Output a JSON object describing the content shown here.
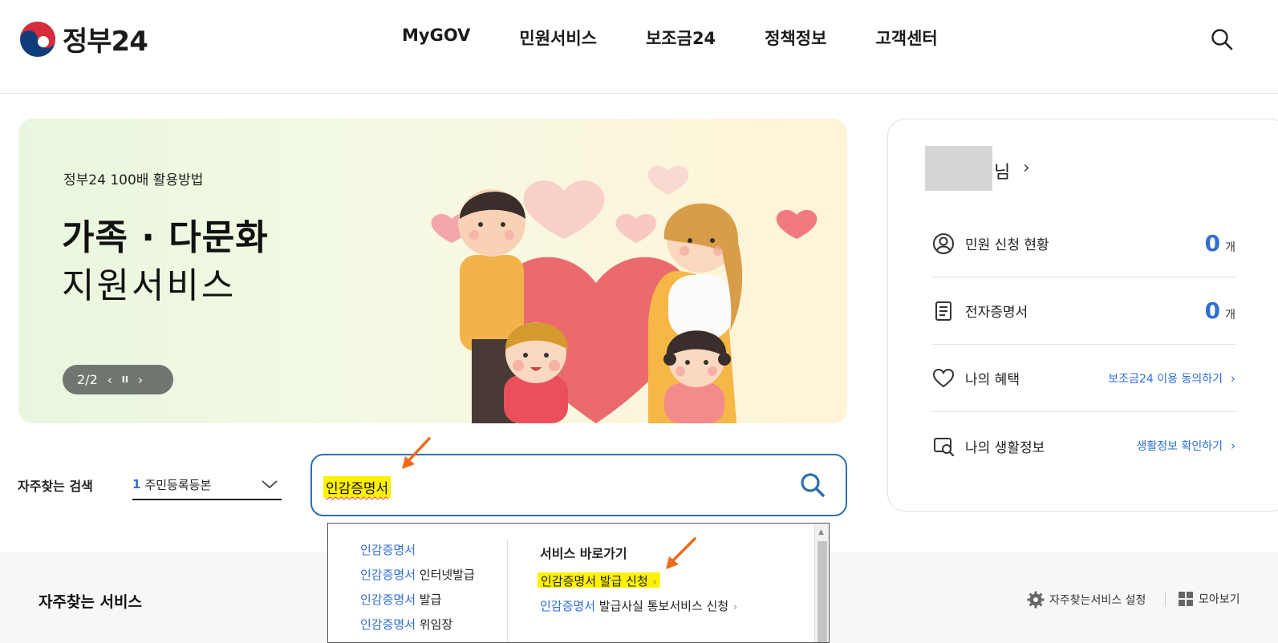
{
  "header": {
    "logo_text": "정부24",
    "nav": [
      "MyGOV",
      "민원서비스",
      "보조금24",
      "정책정보",
      "고객센터"
    ],
    "search_icon": "search-icon"
  },
  "banner": {
    "subtitle": "정부24 100배 활용방법",
    "title_line1": "가족 · 다문화",
    "title_line2": "지원서비스",
    "pager": "2/2",
    "prev_icon": "‹",
    "pause_icon": "II",
    "next_icon": "›"
  },
  "profile": {
    "nim": "님",
    "chevron": "›",
    "rows": [
      {
        "label": "민원 신청 현황",
        "count": "0",
        "unit": "개",
        "icon": "person-circle-icon"
      },
      {
        "label": "전자증명서",
        "count": "0",
        "unit": "개",
        "icon": "document-icon"
      },
      {
        "label": "나의 혜택",
        "link": "보조금24 이용 동의하기",
        "icon": "heart-icon"
      },
      {
        "label": "나의 생활정보",
        "link": "생활정보 확인하기",
        "icon": "search-document-icon"
      }
    ]
  },
  "frequent_search": {
    "label": "자주찾는 검색",
    "selected_num": "1",
    "selected_value": "주민등록등본"
  },
  "search": {
    "value": "인감증명서"
  },
  "autocomplete": {
    "suggestions": [
      {
        "hl": "인감증명서",
        "rest": ""
      },
      {
        "hl": "인감증명서",
        "rest": " 인터넷발급"
      },
      {
        "hl": "인감증명서",
        "rest": " 발급"
      },
      {
        "hl": "인감증명서",
        "rest": " 위임장"
      }
    ],
    "shortcut_heading": "서비스 바로가기",
    "shortcuts": [
      {
        "hl": "인감증명서",
        "rest": " 발급 신청"
      },
      {
        "hl": "인감증명서",
        "rest": " 발급사실 통보서비스 신청"
      }
    ]
  },
  "lower": {
    "title": "자주찾는 서비스",
    "settings_label": "자주찾는서비스 설정",
    "view_all_label": "모아보기"
  },
  "colors": {
    "accent": "#2f6fd1",
    "highlight": "#fff200",
    "arrow": "#f06a1d"
  }
}
